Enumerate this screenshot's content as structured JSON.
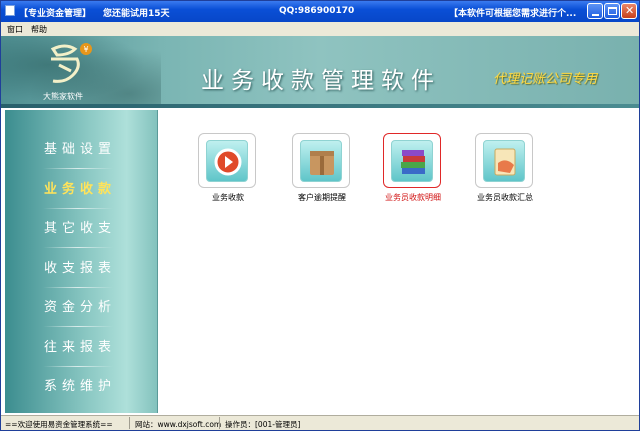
{
  "titlebar": {
    "title": "【专业资金管理】",
    "trial": "您还能试用15天",
    "qq": "QQ:986900170",
    "notice": "【本软件可根据您需求进行个..."
  },
  "menu": {
    "items": [
      "窗口",
      "帮助"
    ]
  },
  "banner": {
    "logo_text": "大熊家软件",
    "main_title": "业务收款管理软件",
    "sub_title": "代理记账公司专用"
  },
  "sidebar": {
    "items": [
      {
        "label": "基础设置",
        "active": false
      },
      {
        "label": "业务收款",
        "active": true
      },
      {
        "label": "其它收支",
        "active": false
      },
      {
        "label": "收支报表",
        "active": false
      },
      {
        "label": "资金分析",
        "active": false
      },
      {
        "label": "往来报表",
        "active": false
      },
      {
        "label": "系统维护",
        "active": false
      }
    ]
  },
  "modules": [
    {
      "label": "业务收款",
      "icon": "play-circle-icon",
      "selected": false
    },
    {
      "label": "客户逾期提醒",
      "icon": "package-box-icon",
      "selected": false
    },
    {
      "label": "业务员收款明细",
      "icon": "books-stack-icon",
      "selected": true
    },
    {
      "label": "业务员收款汇总",
      "icon": "document-hand-icon",
      "selected": false
    }
  ],
  "status": {
    "welcome": "==欢迎使用易资金管理系统==",
    "website": "网站：www.dxjsoft.com",
    "operator": "操作员：[001-管理员]"
  },
  "colors": {
    "accent_active": "#ffe35a",
    "selected_label": "#d01010",
    "subtitle": "#ffd840"
  }
}
